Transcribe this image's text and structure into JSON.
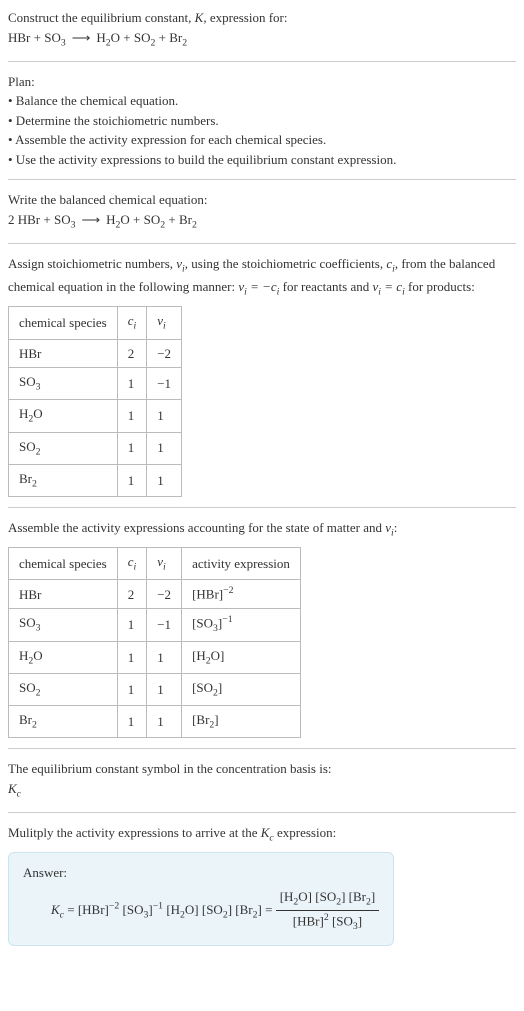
{
  "intro": {
    "line1_a": "Construct the equilibrium constant, ",
    "line1_b": ", expression for:",
    "eq_lhs_1": "HBr",
    "eq_plus": " + ",
    "eq_lhs_2a": "SO",
    "eq_lhs_2b": "3",
    "eq_arrow": "⟶",
    "eq_rhs_1a": "H",
    "eq_rhs_1b": "2",
    "eq_rhs_1c": "O",
    "eq_rhs_2a": "SO",
    "eq_rhs_2b": "2",
    "eq_rhs_3a": "Br",
    "eq_rhs_3b": "2"
  },
  "plan": {
    "title": "Plan:",
    "b1": "• Balance the chemical equation.",
    "b2": "• Determine the stoichiometric numbers.",
    "b3": "• Assemble the activity expression for each chemical species.",
    "b4": "• Use the activity expressions to build the equilibrium constant expression."
  },
  "balanced": {
    "title": "Write the balanced chemical equation:",
    "coef": "2",
    "sp1": "HBr",
    "sp2a": "SO",
    "sp2b": "3",
    "sp3a": "H",
    "sp3b": "2",
    "sp3c": "O",
    "sp4a": "SO",
    "sp4b": "2",
    "sp5a": "Br",
    "sp5b": "2"
  },
  "assign": {
    "text_a": "Assign stoichiometric numbers, ",
    "text_b": ", using the stoichiometric coefficients, ",
    "text_c": ", from the balanced chemical equation in the following manner: ",
    "text_d": " for reactants and ",
    "text_e": " for products:",
    "nu": "ν",
    "bi": "i",
    "ci": "c",
    "eq1a": "ν",
    "eq1b": " = −",
    "eq1c": "c",
    "eq2a": "ν",
    "eq2b": " = ",
    "eq2c": "c"
  },
  "table1": {
    "h1": "chemical species",
    "h2a": "c",
    "h2b": "i",
    "h3a": "ν",
    "h3b": "i",
    "rows": [
      {
        "sp_a": "HBr",
        "sp_b": "",
        "c": "2",
        "v": "−2"
      },
      {
        "sp_a": "SO",
        "sp_b": "3",
        "c": "1",
        "v": "−1"
      },
      {
        "sp_a": "H",
        "sp_b": "2",
        "sp_c": "O",
        "c": "1",
        "v": "1"
      },
      {
        "sp_a": "SO",
        "sp_b": "2",
        "c": "1",
        "v": "1"
      },
      {
        "sp_a": "Br",
        "sp_b": "2",
        "c": "1",
        "v": "1"
      }
    ]
  },
  "assemble": {
    "text_a": "Assemble the activity expressions accounting for the state of matter and ",
    "text_b": ":"
  },
  "table2": {
    "h1": "chemical species",
    "h2a": "c",
    "h2b": "i",
    "h3a": "ν",
    "h3b": "i",
    "h4": "activity expression",
    "rows": [
      {
        "sp_a": "HBr",
        "sp_b": "",
        "c": "2",
        "v": "−2",
        "act_a": "[HBr]",
        "act_exp": "−2"
      },
      {
        "sp_a": "SO",
        "sp_b": "3",
        "c": "1",
        "v": "−1",
        "act_a": "[SO",
        "act_b": "3",
        "act_c": "]",
        "act_exp": "−1"
      },
      {
        "sp_a": "H",
        "sp_b": "2",
        "sp_c": "O",
        "c": "1",
        "v": "1",
        "act_a": "[H",
        "act_b": "2",
        "act_c": "O]"
      },
      {
        "sp_a": "SO",
        "sp_b": "2",
        "c": "1",
        "v": "1",
        "act_a": "[SO",
        "act_b": "2",
        "act_c": "]"
      },
      {
        "sp_a": "Br",
        "sp_b": "2",
        "c": "1",
        "v": "1",
        "act_a": "[Br",
        "act_b": "2",
        "act_c": "]"
      }
    ]
  },
  "symbol": {
    "text": "The equilibrium constant symbol in the concentration basis is:",
    "k": "K",
    "kc": "c"
  },
  "multiply": {
    "text_a": "Mulitply the activity expressions to arrive at the ",
    "text_b": " expression:"
  },
  "answer": {
    "label": "Answer:",
    "k": "K",
    "kc": "c",
    "eq": " = ",
    "t1": "[HBr]",
    "t1e": "−2",
    "t2a": "[SO",
    "t2b": "3",
    "t2c": "]",
    "t2e": "−1",
    "t3a": "[H",
    "t3b": "2",
    "t3c": "O]",
    "t4a": "[SO",
    "t4b": "2",
    "t4c": "]",
    "t5a": "[Br",
    "t5b": "2",
    "t5c": "]",
    "eq2": " = ",
    "num_a": "[H",
    "num_b": "2",
    "num_c": "O] [SO",
    "num_d": "2",
    "num_e": "] [Br",
    "num_f": "2",
    "num_g": "]",
    "den_a": "[HBr]",
    "den_b": "2",
    "den_c": " [SO",
    "den_d": "3",
    "den_e": "]"
  }
}
